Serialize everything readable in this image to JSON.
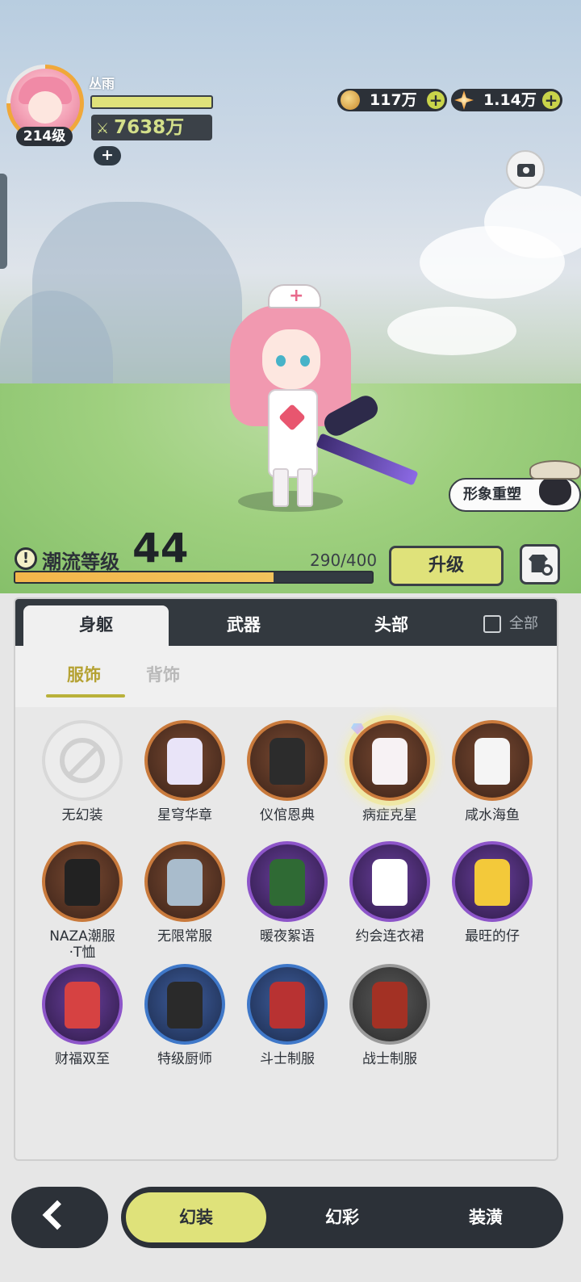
{
  "player": {
    "name": "丛雨",
    "level": "214级",
    "power": "7638万",
    "add_symbol": "+"
  },
  "currencies": [
    {
      "name": "gold-coin-icon",
      "value": "117万",
      "add": "+"
    },
    {
      "name": "star-gem-icon",
      "value": "1.14万",
      "add": "+"
    }
  ],
  "scene": {
    "reshape_label": "形象重塑"
  },
  "trend": {
    "label": "潮流等级",
    "level": "44",
    "progress_text": "290/400",
    "progress_current": 290,
    "progress_max": 400,
    "upgrade_label": "升级",
    "warn_symbol": "!"
  },
  "tabs": {
    "items": [
      {
        "label": "身躯",
        "active": true
      },
      {
        "label": "武器",
        "active": false
      },
      {
        "label": "头部",
        "active": false
      }
    ],
    "all_label": "全部"
  },
  "subtabs": {
    "items": [
      {
        "label": "服饰",
        "active": true
      },
      {
        "label": "背饰",
        "active": false
      }
    ]
  },
  "outfits": [
    {
      "label": "无幻装",
      "rarity": "none"
    },
    {
      "label": "星穹华章",
      "rarity": "orange"
    },
    {
      "label": "仪倌恩典",
      "rarity": "orange"
    },
    {
      "label": "病症克星",
      "rarity": "orange",
      "selected": true
    },
    {
      "label": "咸水海鱼",
      "rarity": "orange"
    },
    {
      "label": "NAZA潮服\n·T恤",
      "rarity": "orange"
    },
    {
      "label": "无限常服",
      "rarity": "orange"
    },
    {
      "label": "暖夜絮语",
      "rarity": "purple"
    },
    {
      "label": "约会连衣裙",
      "rarity": "purple"
    },
    {
      "label": "最旺的仔",
      "rarity": "purple"
    },
    {
      "label": "财福双至",
      "rarity": "purple"
    },
    {
      "label": "特级厨师",
      "rarity": "blue"
    },
    {
      "label": "斗士制服",
      "rarity": "blue"
    },
    {
      "label": "战士制服",
      "rarity": "gray"
    }
  ],
  "bottom_nav": {
    "items": [
      {
        "label": "幻装",
        "active": true
      },
      {
        "label": "幻彩",
        "active": false
      },
      {
        "label": "装潢",
        "active": false
      }
    ]
  },
  "colors": {
    "accent_lime": "#dfe27a",
    "dark": "#2c3138",
    "rarity_orange": "#c97a3c",
    "rarity_purple": "#8d55c9",
    "rarity_blue": "#3f78c9",
    "rarity_gray": "#9a9a9a"
  }
}
